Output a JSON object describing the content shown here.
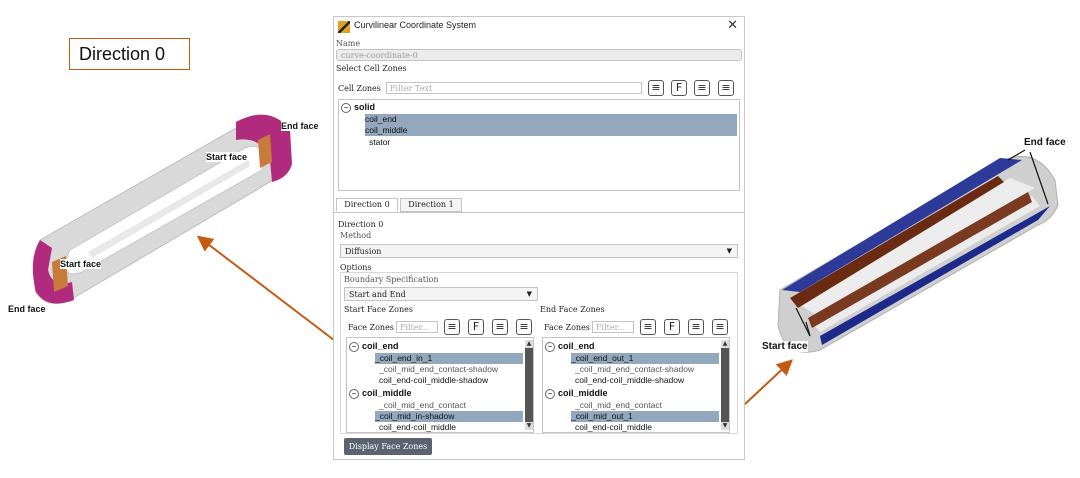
{
  "annotation": {
    "direction_box_label": "Direction 0",
    "left_end_face_top": "End face",
    "left_start_face_top": "Start face",
    "left_start_face_bottom": "Start face",
    "left_end_face_bottom": "End face",
    "right_end_face": "End face",
    "right_start_face": "Start face"
  },
  "dialog": {
    "title": "Curvilinear Coordinate System",
    "close": "✕",
    "name_label": "Name",
    "name_value": "curve-coordinate-0",
    "select_cell_zones": "Select Cell Zones",
    "cell_zones_label": "Cell Zones",
    "cell_zones_filter_placeholder": "Filter Text",
    "cell_tree": {
      "group": "solid",
      "items": [
        "coil_end",
        "coil_middle",
        "stator"
      ]
    },
    "tabs": [
      "Direction 0",
      "Direction 1"
    ],
    "direction_heading": "Direction 0",
    "method_label": "Method",
    "method_value": "Diffusion",
    "options_label": "Options",
    "boundary_spec_label": "Boundary Specification",
    "boundary_spec_value": "Start and End",
    "start_face_zones_label": "Start Face Zones",
    "end_face_zones_label": "End Face Zones",
    "face_zones_label": "Face Zones",
    "face_filter_placeholder": "Filter...",
    "start_list": {
      "group1": "coil_end",
      "group1_items": [
        "_coil_end_in_1",
        "_coil_mid_end_contact-shadow",
        "coil_end-coil_middle-shadow"
      ],
      "group2": "coil_middle",
      "group2_items": [
        "_coil_mid_end_contact",
        "_coil_mid_in-shadow",
        "coil_end-coil_middle"
      ]
    },
    "end_list": {
      "group1": "coil_end",
      "group1_items": [
        "_coil_end_out_1",
        "_coil_mid_end_contact-shadow",
        "coil_end-coil_middle-shadow"
      ],
      "group2": "coil_middle",
      "group2_items": [
        "_coil_mid_end_contact",
        "_coil_mid_out_1",
        "coil_end-coil_middle"
      ]
    },
    "display_button": "Display Face Zones"
  },
  "colors": {
    "selection": "#94a8bd",
    "arrow": "#c55a11",
    "magenta": "#b02a7e",
    "copper": "#c87a3a",
    "navy": "#2a2a8e",
    "brown": "#6b2a12"
  }
}
